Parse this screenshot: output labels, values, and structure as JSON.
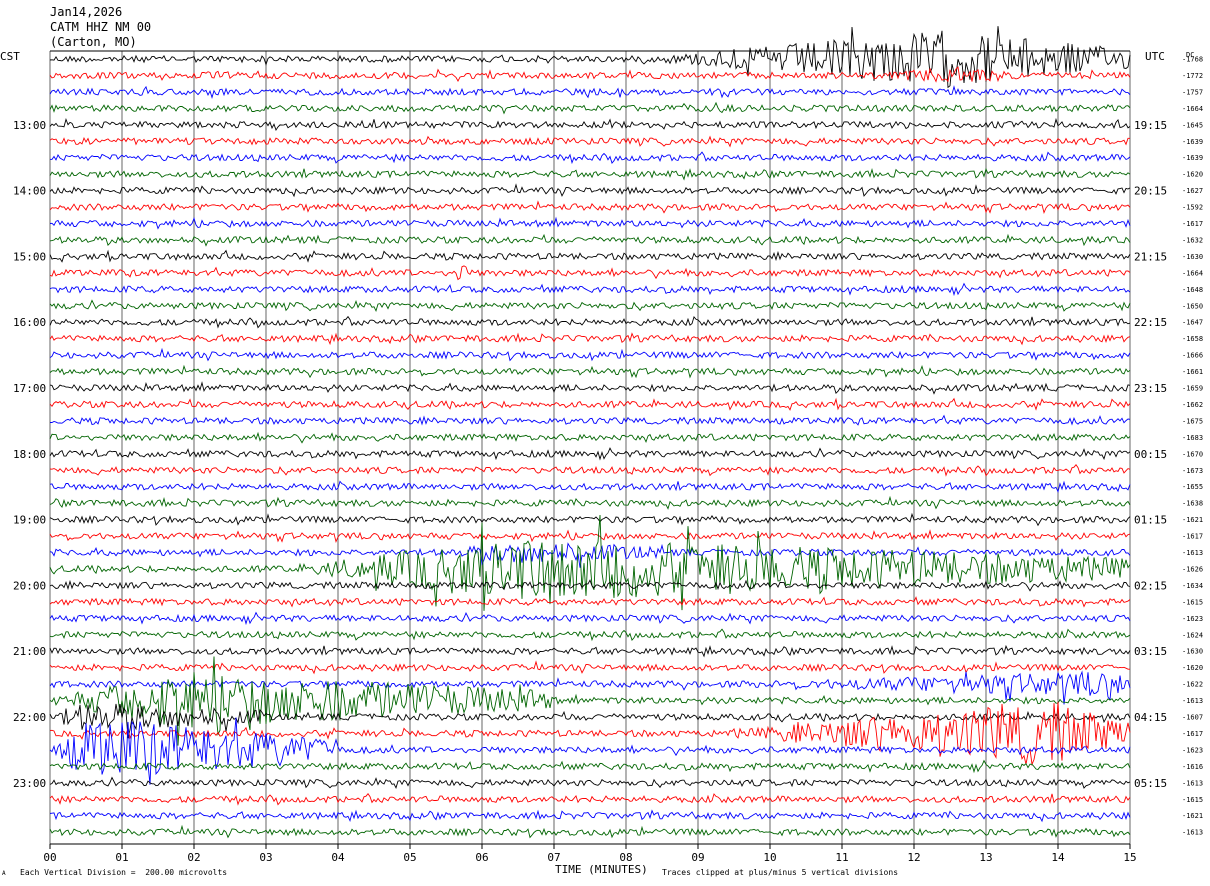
{
  "header": {
    "date": "Jan14,2026",
    "station": "CATM HHZ NM 00",
    "location": "(Carton, MO)"
  },
  "footer": {
    "scale_text": "Each Vertical Division =  200.00 microvolts",
    "clip_text": "Traces clipped at plus/minus 5 vertical divisions",
    "small_mark": "A"
  },
  "chart_data": {
    "type": "line",
    "subtype": "helicorder",
    "xlabel": "TIME (MINUTES)",
    "x_ticks": [
      "00",
      "01",
      "02",
      "03",
      "04",
      "05",
      "06",
      "07",
      "08",
      "09",
      "10",
      "11",
      "12",
      "13",
      "14",
      "15"
    ],
    "xlim": [
      0,
      15
    ],
    "left_axis_title": "CST",
    "right_axis_title": "UTC",
    "dc_title": "DC",
    "line_minutes": 15,
    "line_colors": [
      "#000000",
      "#ff0000",
      "#0000ff",
      "#006400"
    ],
    "grid": true,
    "left_hour_labels": [
      {
        "line": 4,
        "text": "13:00"
      },
      {
        "line": 8,
        "text": "14:00"
      },
      {
        "line": 12,
        "text": "15:00"
      },
      {
        "line": 16,
        "text": "16:00"
      },
      {
        "line": 20,
        "text": "17:00"
      },
      {
        "line": 24,
        "text": "18:00"
      },
      {
        "line": 28,
        "text": "19:00"
      },
      {
        "line": 32,
        "text": "20:00"
      },
      {
        "line": 36,
        "text": "21:00"
      },
      {
        "line": 40,
        "text": "22:00"
      },
      {
        "line": 44,
        "text": "23:00"
      }
    ],
    "right_hour_labels": [
      {
        "line": 4,
        "text": "19:15"
      },
      {
        "line": 8,
        "text": "20:15"
      },
      {
        "line": 12,
        "text": "21:15"
      },
      {
        "line": 16,
        "text": "22:15"
      },
      {
        "line": 20,
        "text": "23:15"
      },
      {
        "line": 24,
        "text": "00:15"
      },
      {
        "line": 28,
        "text": "01:15"
      },
      {
        "line": 32,
        "text": "02:15"
      },
      {
        "line": 36,
        "text": "03:15"
      },
      {
        "line": 40,
        "text": "04:15"
      },
      {
        "line": 44,
        "text": "05:15"
      }
    ],
    "dc_offsets": [
      "-1768",
      "-1772",
      "-1757",
      "-1664",
      "-1645",
      "-1639",
      "-1639",
      "-1620",
      "-1627",
      "-1592",
      "-1617",
      "-1632",
      "-1630",
      "-1664",
      "-1648",
      "-1650",
      "-1647",
      "-1658",
      "-1666",
      "-1661",
      "-1659",
      "-1662",
      "-1675",
      "-1683",
      "-1670",
      "-1673",
      "-1655",
      "-1638",
      "-1621",
      "-1617",
      "-1613",
      "-1626",
      "-1634",
      "-1615",
      "-1623",
      "-1624",
      "-1630",
      "-1620",
      "-1622",
      "-1613",
      "-1607",
      "-1617",
      "-1623",
      "-1616",
      "-1613",
      "-1615",
      "-1621",
      "-1613"
    ],
    "events": [
      {
        "line": 0,
        "start_min": 8.5,
        "end_min": 15,
        "peak_min": 12.4,
        "amp": 26
      },
      {
        "line": 1,
        "start_min": 11.7,
        "end_min": 13.3,
        "peak_min": 12.5,
        "amp": 6
      },
      {
        "line": 13,
        "start_min": 5.55,
        "end_min": 5.8,
        "peak_min": 5.65,
        "amp": 12
      },
      {
        "line": 31,
        "start_min": 3.5,
        "end_min": 15,
        "peak_min": 6.4,
        "amp": 30
      },
      {
        "line": 30,
        "start_min": 5.5,
        "end_min": 8.5,
        "peak_min": 6.5,
        "amp": 8
      },
      {
        "line": 38,
        "start_min": 10,
        "end_min": 15,
        "peak_min": 14.8,
        "amp": 10
      },
      {
        "line": 39,
        "start_min": 0,
        "end_min": 7,
        "peak_min": 1.8,
        "amp": 26
      },
      {
        "line": 40,
        "start_min": 0,
        "end_min": 3,
        "peak_min": 0.5,
        "amp": 12
      },
      {
        "line": 41,
        "start_min": 9.5,
        "end_min": 15,
        "peak_min": 13.8,
        "amp": 30
      },
      {
        "line": 42,
        "start_min": 0,
        "end_min": 4,
        "peak_min": 0.6,
        "amp": 30
      }
    ]
  }
}
